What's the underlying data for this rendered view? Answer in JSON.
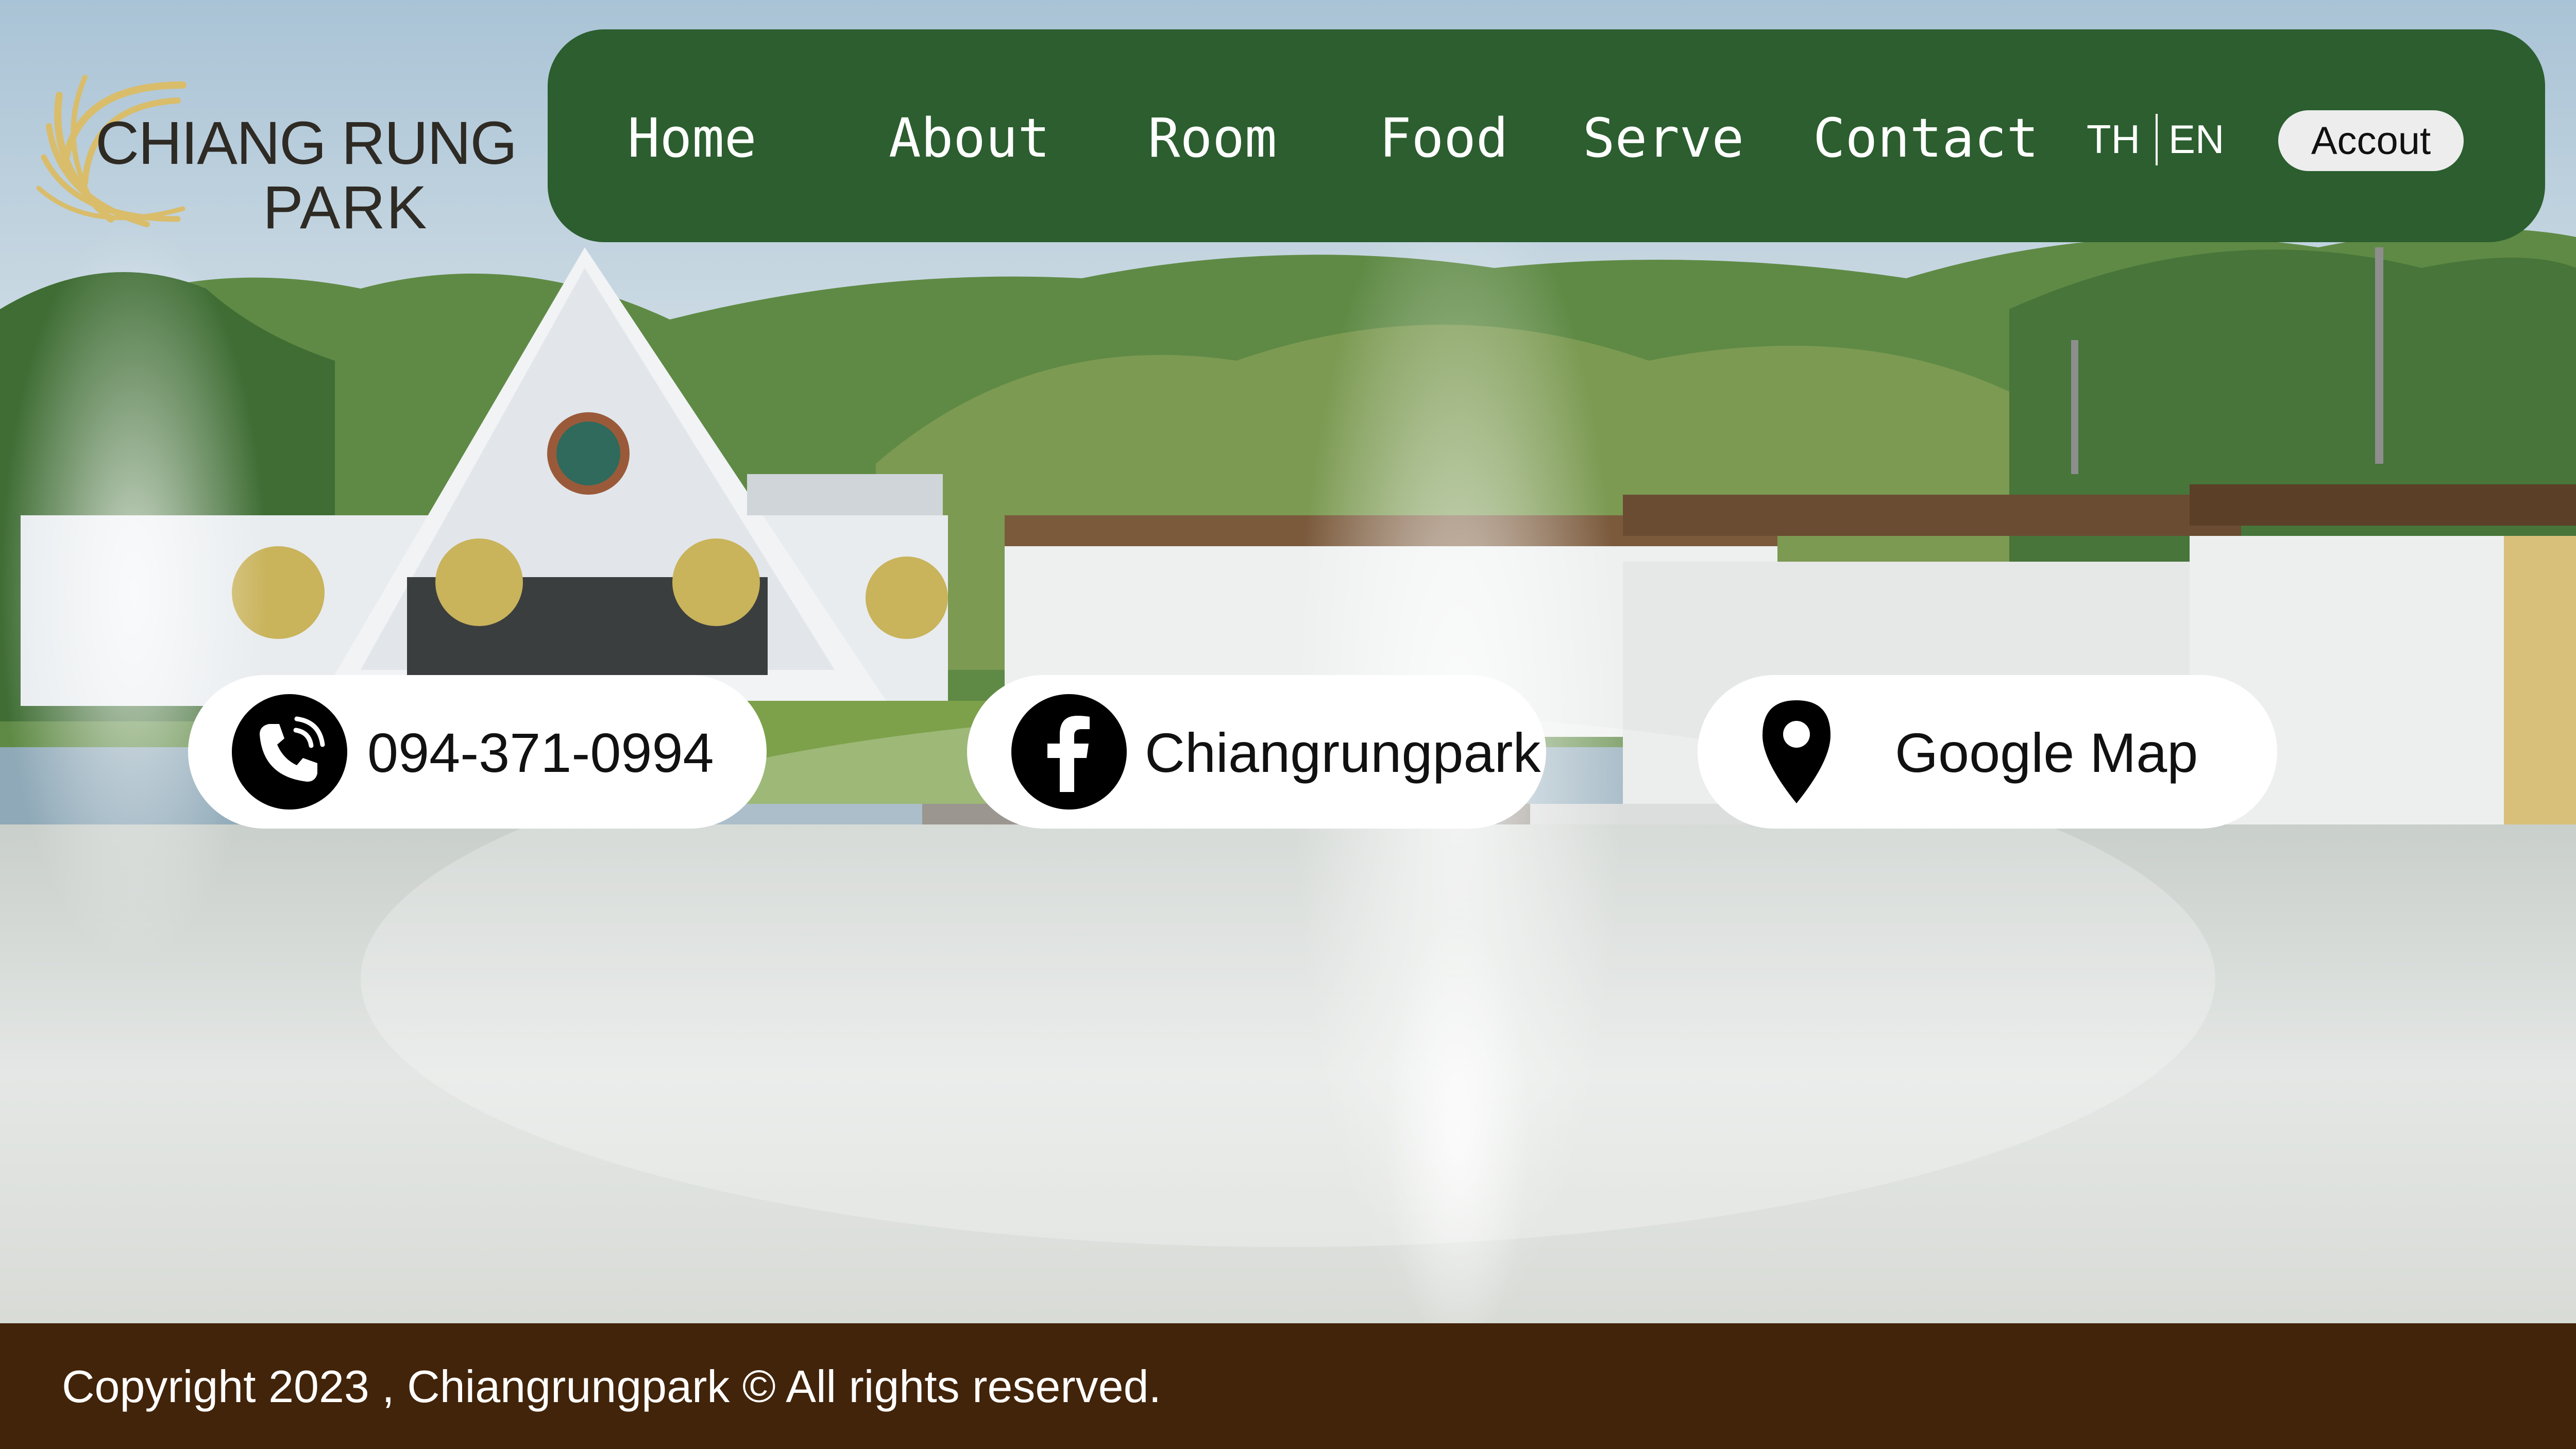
{
  "brand": {
    "line1": "CHIANG RUNG",
    "line2": "PARK",
    "logo_color": "#d9bd6b"
  },
  "nav": {
    "items": [
      {
        "label": "Home"
      },
      {
        "label": "About"
      },
      {
        "label": "Room"
      },
      {
        "label": "Food"
      },
      {
        "label": "Serve"
      },
      {
        "label": "Contact"
      }
    ],
    "lang_th": "TH",
    "lang_en": "EN",
    "account_label": "Accout",
    "bg_color": "#2c5e2f"
  },
  "contacts": {
    "phone": {
      "label": "094-371-0994",
      "icon": "phone-icon"
    },
    "facebook": {
      "label": "Chiangrungpark",
      "icon": "facebook-icon"
    },
    "map": {
      "label": "Google Map",
      "icon": "map-pin-icon"
    }
  },
  "footer": {
    "copyright": "Copyright 2023 , Chiangrungpark © All rights reserved.",
    "bg_color": "#42240a"
  }
}
